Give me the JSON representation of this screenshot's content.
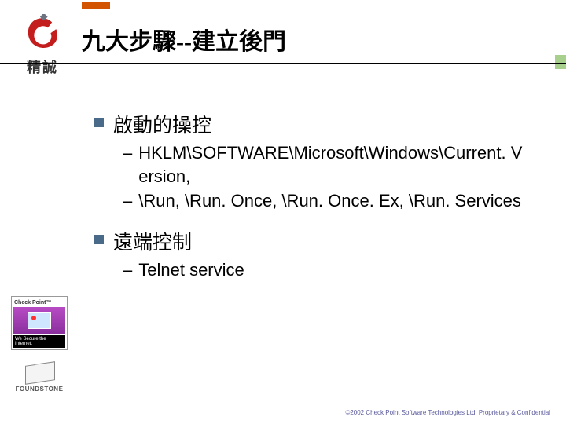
{
  "logo": {
    "brand_text": "精誠"
  },
  "title": "九大步驟--建立後門",
  "bullets": [
    {
      "title": "啟動的操控",
      "subs": [
        "HKLM\\SOFTWARE\\Microsoft\\Windows\\Current. V ersion,",
        "\\Run, \\Run. Once, \\Run. Once. Ex, \\Run. Services"
      ]
    },
    {
      "title": "遠端控制",
      "subs": [
        "Telnet service"
      ]
    }
  ],
  "checkpoint": {
    "top": "Check Point",
    "tm": "™",
    "bottom": "We Secure the Internet."
  },
  "foundstone": "FOUNDSTONE",
  "footer": "©2002 Check Point Software Technologies Ltd.  Proprietary & Confidential"
}
